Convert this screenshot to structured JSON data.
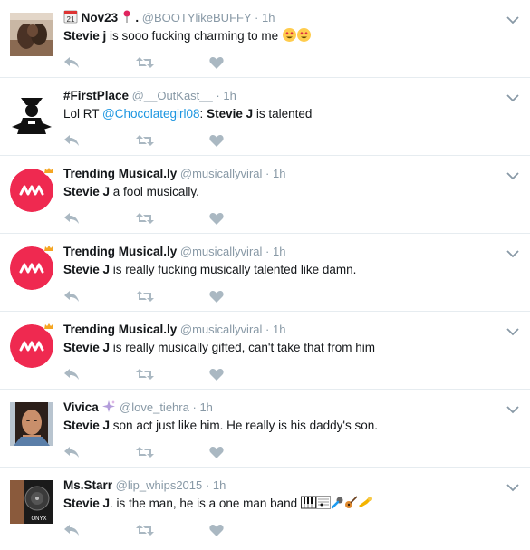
{
  "tweets": [
    {
      "name": "Nov23",
      "name_suffix": ".",
      "handle": "@BOOTYlikeBUFFY",
      "time": "1h",
      "bold": "Stevie j",
      "text": " is sooo fucking charming to me",
      "calendar_text": "21",
      "emojis": [
        "heart-eyes-emoji",
        "heart-eyes-emoji"
      ],
      "avatar": "photo"
    },
    {
      "name": "#FirstPlace",
      "handle": "@__OutKast__",
      "time": "1h",
      "prefix": "Lol RT ",
      "mention": "@Chocolategirl08",
      "colon": ": ",
      "bold": "Stevie J",
      "text": " is talented",
      "avatar": "dark-figure"
    },
    {
      "name": "Trending Musical.ly",
      "handle": "@musicallyviral",
      "time": "1h",
      "bold": "Stevie J",
      "text": " a fool musically.",
      "avatar": "musically-logo"
    },
    {
      "name": "Trending Musical.ly",
      "handle": "@musicallyviral",
      "time": "1h",
      "bold": "Stevie J",
      "text": " is really fucking musically talented like damn.",
      "avatar": "musically-logo"
    },
    {
      "name": "Trending Musical.ly",
      "handle": "@musicallyviral",
      "time": "1h",
      "bold": "Stevie J",
      "text": " is really musically gifted, can't take that from him",
      "avatar": "musically-logo"
    },
    {
      "name": "Vivica",
      "handle": "@love_tiehra",
      "time": "1h",
      "bold": "Stevie J",
      "text": " son act just like him. He really is his daddy's son.",
      "avatar": "photo-woman"
    },
    {
      "name": "Ms.Starr",
      "handle": "@lip_whips2015",
      "time": "1h",
      "bold": "Stevie J",
      "text": ". is the man, he is a one man band",
      "emojis": [
        "piano-emoji",
        "music-score-emoji",
        "microphone-emoji",
        "guitar-emoji",
        "trumpet-emoji"
      ],
      "avatar": "onyx-photo",
      "avatar_label": "ONYX"
    }
  ],
  "colors": {
    "accent": "#1b95e0",
    "muted": "#8899a6",
    "icon": "#aab8c2",
    "musically": "#ef2950"
  }
}
